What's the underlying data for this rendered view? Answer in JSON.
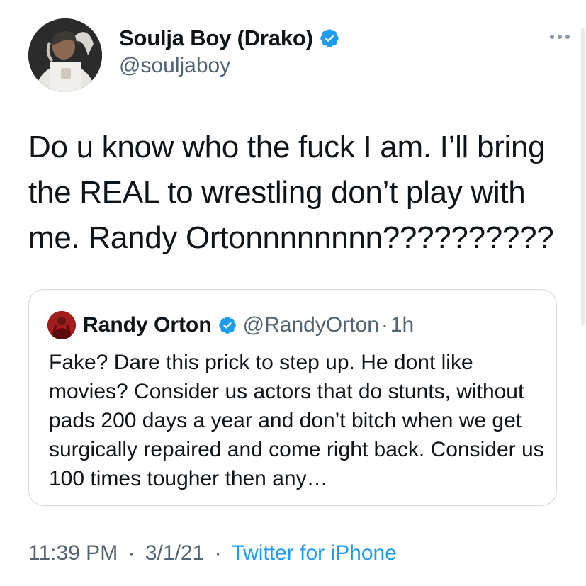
{
  "tweet": {
    "author": {
      "name": "Soulja Boy (Drako)",
      "handle": "@souljaboy",
      "verified": true,
      "avatar_icon": "profile-photo"
    },
    "more_icon": "more-horizontal-icon",
    "text": "Do u know who the fuck I am. I’ll bring the REAL to wrestling don’t play with me. Randy Ortonnnnnnnn??????????",
    "quoted": {
      "author_name": "Randy Orton",
      "author_handle": "@RandyOrton",
      "verified": true,
      "separator": "·",
      "time": "1h",
      "text": "Fake? Dare this prick to step up. He dont like movies? Consider us actors that do stunts, without pads 200 days a year and don’t bitch when we get surgically repaired and come right back. Consider us 100 times tougher then any…"
    },
    "meta": {
      "time": "11:39 PM",
      "separator": "·",
      "date": "3/1/21",
      "separator2": "·",
      "source": "Twitter for iPhone"
    }
  },
  "colors": {
    "text_primary": "#0f1419",
    "text_secondary": "#536471",
    "accent": "#1d9bf0",
    "border": "#cfd9de"
  }
}
